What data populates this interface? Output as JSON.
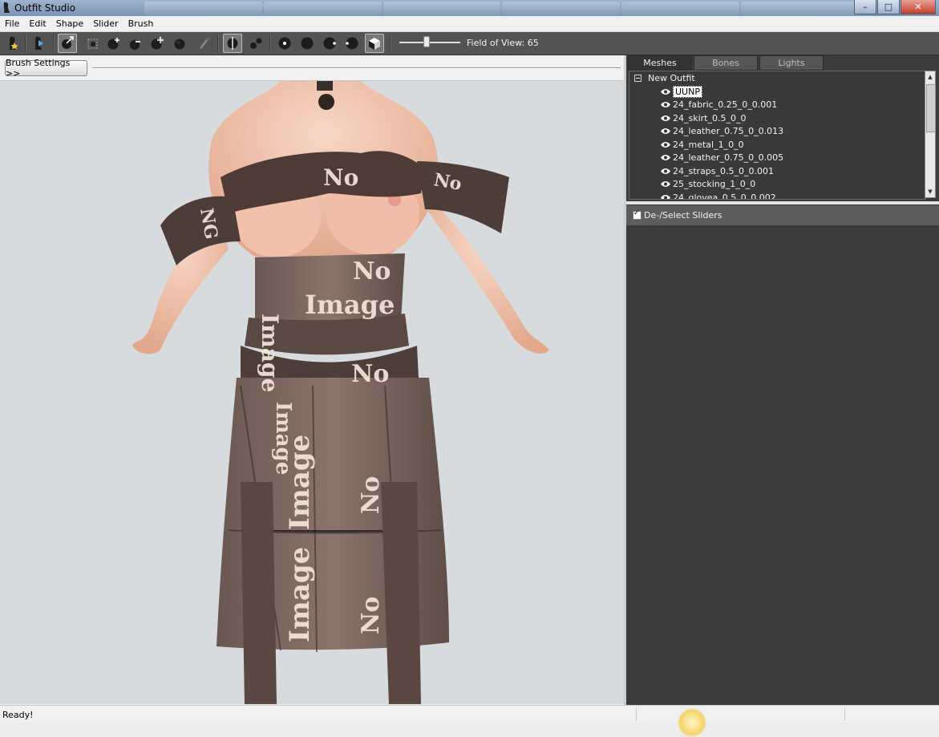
{
  "window": {
    "title": "Outfit Studio",
    "controls": [
      "–",
      "□",
      "✕"
    ]
  },
  "menu": [
    "File",
    "Edit",
    "Shape",
    "Slider",
    "Brush"
  ],
  "toolbar": {
    "field_of_view_label": "Field of View: 65",
    "field_of_view_value": 65
  },
  "brush_settings_label": "Brush Settings >>",
  "tabs": [
    "Meshes",
    "Bones",
    "Lights"
  ],
  "active_tab": "Meshes",
  "tree": {
    "root": "New Outfit",
    "items": [
      "UUNP",
      "24_fabric_0.25_0_0.001",
      "24_skirt_0.5_0_0",
      "24_leather_0.75_0_0.013",
      "24_metal_1_0_0",
      "24_leather_0.75_0_0.005",
      "24_straps_0.5_0_0.001",
      "25_stocking_1_0_0",
      "24_glovea_0.5_0_0.002"
    ],
    "selected": "UUNP"
  },
  "sliders": {
    "toggle_label": "De-/Select Sliders",
    "checked": true
  },
  "status": "Ready!",
  "viewport": {
    "texture_words": [
      "No",
      "Image",
      "No",
      "Image",
      "No",
      "Image",
      "No",
      "Image",
      "No",
      "Image",
      "No",
      "NG"
    ]
  }
}
